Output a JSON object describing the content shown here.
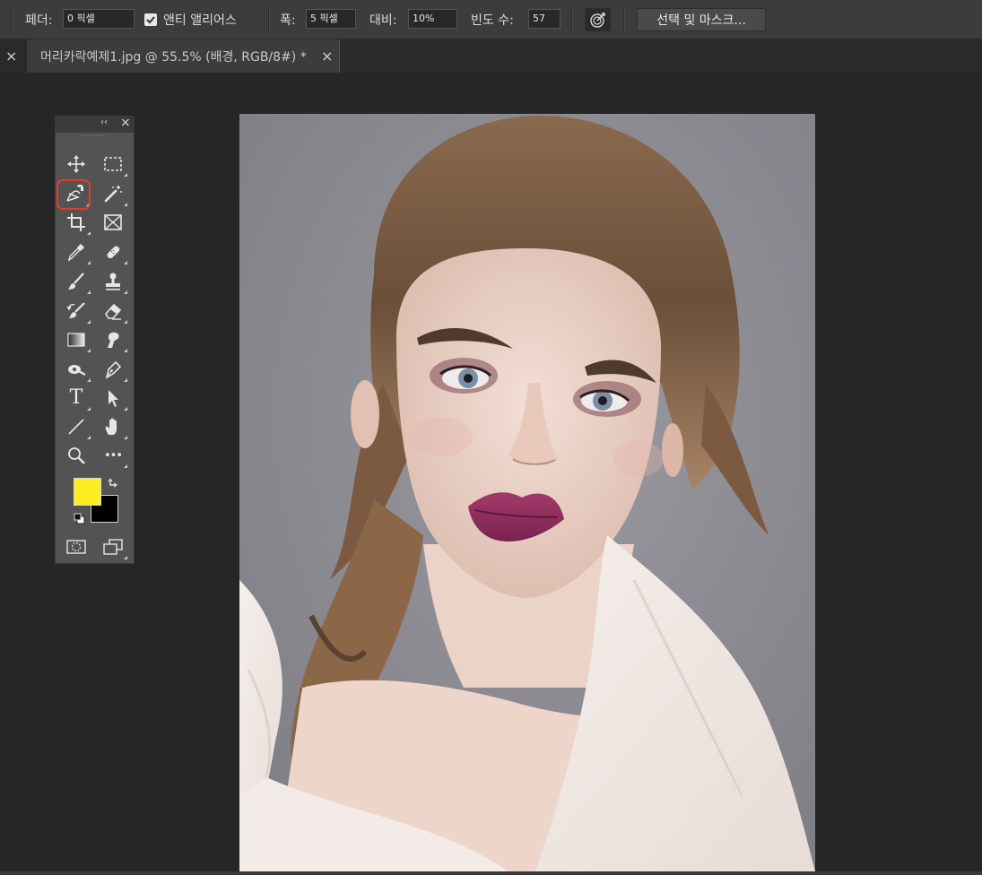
{
  "options_bar": {
    "feather_label": "페더:",
    "feather_value": "0 픽셀",
    "antialias_label": "앤티 앨리어스",
    "antialias_checked": true,
    "width_label": "폭:",
    "width_value": "5 픽셀",
    "contrast_label": "대비:",
    "contrast_value": "10%",
    "frequency_label": "빈도 수:",
    "frequency_value": "57",
    "pen_pressure_icon": "stylus-pressure-icon",
    "select_mask_label": "선택 및 마스크..."
  },
  "document_tab": {
    "title": "머리카락예제1.jpg @ 55.5% (배경, RGB/8#) *",
    "close_glyph": "×"
  },
  "panel_close_glyph": "×",
  "toolbox": {
    "collapse_glyph": "‹‹",
    "close_glyph": "×",
    "tools": [
      {
        "icon": "move-icon"
      },
      {
        "icon": "rectangular-marquee-icon"
      },
      {
        "icon": "magnetic-lasso-icon",
        "selected": true
      },
      {
        "icon": "magic-wand-icon"
      },
      {
        "icon": "crop-icon"
      },
      {
        "icon": "frame-icon"
      },
      {
        "icon": "eyedropper-icon"
      },
      {
        "icon": "healing-brush-icon"
      },
      {
        "icon": "brush-icon"
      },
      {
        "icon": "clone-stamp-icon"
      },
      {
        "icon": "history-brush-icon"
      },
      {
        "icon": "eraser-icon"
      },
      {
        "icon": "gradient-icon"
      },
      {
        "icon": "smudge-icon"
      },
      {
        "icon": "dodge-icon"
      },
      {
        "icon": "pen-icon"
      },
      {
        "icon": "type-icon"
      },
      {
        "icon": "path-selection-icon"
      },
      {
        "icon": "line-icon"
      },
      {
        "icon": "hand-icon"
      },
      {
        "icon": "zoom-icon"
      },
      {
        "icon": "more-tools-icon"
      }
    ],
    "type_tool_glyph": "T",
    "more_tools_glyph": "•••",
    "foreground_color": "#ffee1f",
    "background_color": "#000000",
    "quick_mask_icon": "quick-mask-icon",
    "screen_mode_icon": "screen-mode-icon"
  },
  "canvas": {
    "image_subject": "portrait-photo"
  },
  "colors": {
    "app_bg": "#262626",
    "options_bar_bg": "#3c3c3c",
    "toolbox_bg": "#535353",
    "highlight": "#e53a2f",
    "photo_bg": "#8a8990"
  }
}
